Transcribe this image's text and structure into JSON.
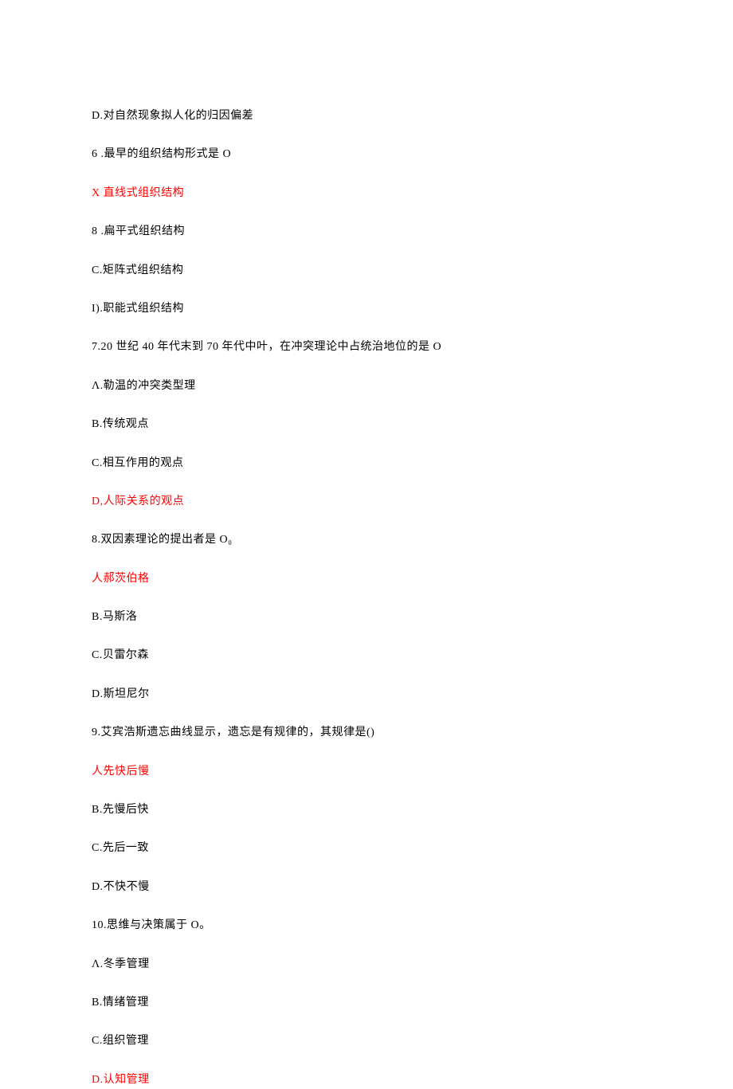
{
  "lines": [
    {
      "text": "D.对自然现象拟人化的归因偏差",
      "red": false
    },
    {
      "text": "6 .最早的组织结构形式是 O",
      "red": false
    },
    {
      "text": "X 直线式组织结构",
      "red": true
    },
    {
      "text": "8 .扁平式组织结构",
      "red": false
    },
    {
      "text": "C.矩阵式组织结构",
      "red": false
    },
    {
      "text": "I).职能式组织结构",
      "red": false
    },
    {
      "text": "7.20 世纪 40 年代末到 70 年代中叶，在冲突理论中占统治地位的是 O",
      "red": false
    },
    {
      "text": "Λ.勒温的冲突类型理",
      "red": false
    },
    {
      "text": "B.传统观点",
      "red": false
    },
    {
      "text": "C.相互作用的观点",
      "red": false
    },
    {
      "text": "D,人际关系的观点",
      "red": true
    },
    {
      "text": "8.双因素理论的提出者是 O₀",
      "red": false
    },
    {
      "text": "人郝茨伯格",
      "red": true
    },
    {
      "text": "B.马斯洛",
      "red": false
    },
    {
      "text": "C.贝雷尔森",
      "red": false
    },
    {
      "text": "D.斯坦尼尔",
      "red": false
    },
    {
      "text": "9.艾宾浩斯遗忘曲线显示，遗忘是有规律的，其规律是()",
      "red": false
    },
    {
      "text": "人先快后慢",
      "red": true
    },
    {
      "text": "B.先慢后快",
      "red": false
    },
    {
      "text": "C.先后一致",
      "red": false
    },
    {
      "text": "D.不快不慢",
      "red": false
    },
    {
      "text": "10.思维与决策属于 O。",
      "red": false
    },
    {
      "text": "Λ.冬季管理",
      "red": false
    },
    {
      "text": "B.情绪管理",
      "red": false
    },
    {
      "text": "C.组织管理",
      "red": false
    },
    {
      "text": "D.认知管理",
      "red": true
    }
  ]
}
